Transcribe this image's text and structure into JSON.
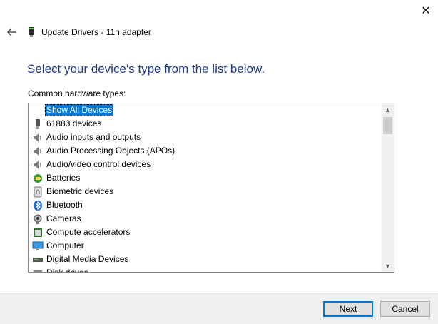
{
  "window": {
    "close_glyph": "✕"
  },
  "wizard": {
    "back_icon": "back-arrow-icon",
    "title": "Update Drivers - 11n adapter",
    "heading": "Select your device's type from the list below.",
    "list_label": "Common hardware types:"
  },
  "hardware_types": [
    {
      "label": "Show All Devices",
      "icon": "none",
      "selected": true
    },
    {
      "label": "61883 devices",
      "icon": "usb-plug-icon"
    },
    {
      "label": "Audio inputs and outputs",
      "icon": "speaker-icon"
    },
    {
      "label": "Audio Processing Objects (APOs)",
      "icon": "speaker-icon"
    },
    {
      "label": "Audio/video control devices",
      "icon": "speaker-icon"
    },
    {
      "label": "Batteries",
      "icon": "battery-icon"
    },
    {
      "label": "Biometric devices",
      "icon": "fingerprint-icon"
    },
    {
      "label": "Bluetooth",
      "icon": "bluetooth-icon"
    },
    {
      "label": "Cameras",
      "icon": "webcam-icon"
    },
    {
      "label": "Compute accelerators",
      "icon": "chip-icon"
    },
    {
      "label": "Computer",
      "icon": "monitor-icon"
    },
    {
      "label": "Digital Media Devices",
      "icon": "media-device-icon"
    },
    {
      "label": "Disk drives",
      "icon": "disk-drive-icon"
    }
  ],
  "buttons": {
    "next": "Next",
    "cancel": "Cancel"
  },
  "scrollbar": {
    "up_glyph": "▲",
    "down_glyph": "▼"
  }
}
